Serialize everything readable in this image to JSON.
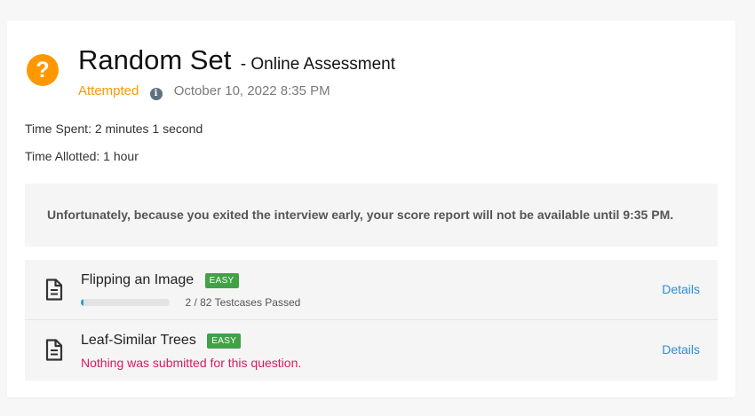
{
  "header": {
    "title": "Random Set",
    "subtitle": "- Online Assessment",
    "status": "Attempted",
    "date": "October 10, 2022 8:35 PM",
    "icon": "question-icon",
    "info_icon": "info-icon"
  },
  "stats": {
    "time_spent": "Time Spent: 2 minutes 1 second",
    "time_allotted": "Time Allotted: 1 hour"
  },
  "notice": "Unfortunately, because you exited the interview early, your score report will not be available until 9:35 PM.",
  "questions": [
    {
      "title": "Flipping an Image",
      "difficulty": "EASY",
      "passed": 2,
      "total": 82,
      "progress_text": "2 / 82 Testcases Passed",
      "details_label": "Details"
    },
    {
      "title": "Leaf-Similar Trees",
      "difficulty": "EASY",
      "note": "Nothing was submitted for this question.",
      "details_label": "Details"
    }
  ],
  "colors": {
    "accent_orange": "#ff9800",
    "easy_green": "#43a047",
    "link_blue": "#2b8fd6",
    "error_pink": "#d81b60",
    "progress_teal": "#26a0c8"
  }
}
